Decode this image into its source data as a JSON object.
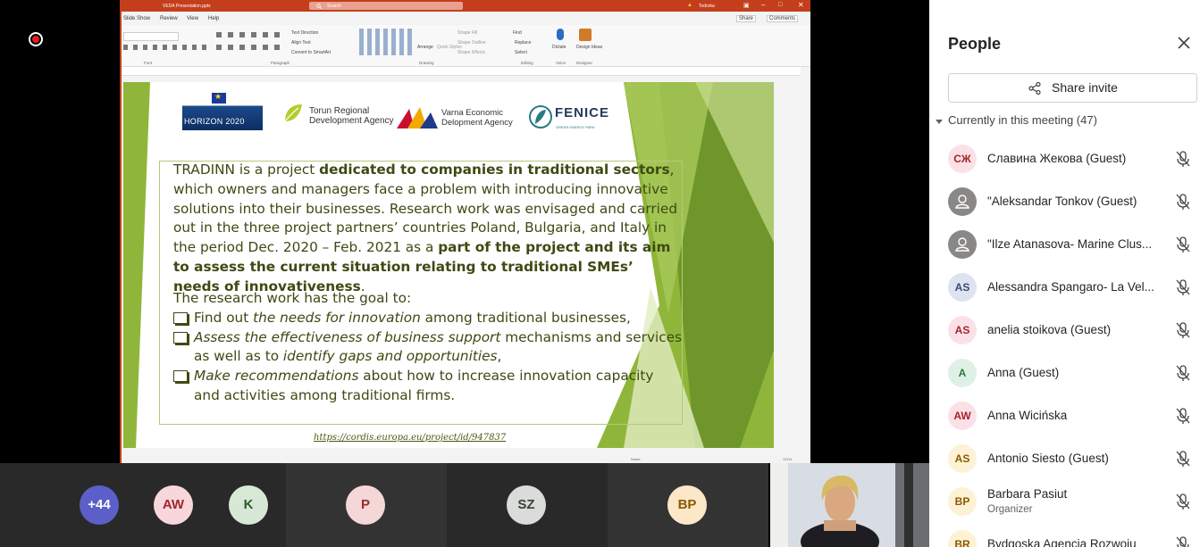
{
  "recording_indicator": "recording",
  "ppt": {
    "file_title": "VEDA Presentation.pptx",
    "search_placeholder": "Search",
    "user_name": "Todorka",
    "share_label": "Share",
    "comments_label": "Comments",
    "menus": [
      "Slide Show",
      "Review",
      "View",
      "Help"
    ],
    "ribbon_groups": [
      "Font",
      "Paragraph",
      "Drawing",
      "Editing",
      "Voice",
      "Designer"
    ],
    "ribbon_buttons": {
      "text_direction": "Text Direction",
      "align_text": "Align Text",
      "convert_smartart": "Convert to SmartArt",
      "arrange": "Arrange",
      "quick_styles": "Quick Styles",
      "shape_fill": "Shape Fill",
      "shape_outline": "Shape Outline",
      "shape_effects": "Shape Effects",
      "find": "Find",
      "replace": "Replace",
      "select": "Select",
      "dictate": "Dictate",
      "design_ideas": "Design Ideas"
    },
    "status": {
      "notes": "Notes",
      "zoom": "121%"
    }
  },
  "slide": {
    "logos": {
      "horizon": "HORIZON 2020",
      "torun": "Torun Regional Development Agency",
      "varna": "Varna Economic Delopment Agency",
      "fenice": "FENICE",
      "fenice_sub": "GREEN ENERGY PARK"
    },
    "para": {
      "p1": "TRADINN is a project ",
      "p1b": "dedicated to companies in traditional sectors",
      "p2": ", which owners and managers face a problem with introducing innovative solutions into their businesses.  Research work was envisaged and carried out in the three project partners’ countries Poland, Bulgaria, and Italy in the period Dec. 2020 – Feb. 2021 as a ",
      "p2b": "part of the project  and its aim to assess the current situation relating to traditional SMEs’ needs of innovativeness",
      "p3": "."
    },
    "goals_intro": "The research work has the goal to:",
    "goals": [
      {
        "pre": "Find out ",
        "em": "the needs for innovation",
        "post": " among traditional businesses,"
      },
      {
        "pre": "",
        "em": "Assess the effectiveness of business support",
        "post": " mechanisms and services as well as to  ",
        "em2": "identify gaps and opportunities",
        "post2": ","
      },
      {
        "pre": "",
        "em": "Make recommendations",
        "post": " about how to increase innovation capacity and activities among traditional firms."
      }
    ],
    "url": "https://cordis.europa.eu/project/id/947837"
  },
  "people": {
    "title": "People",
    "share_invite": "Share invite",
    "section": "Currently in this meeting (47)",
    "participants": [
      {
        "initials": "СЖ",
        "name": "Славина Жекова (Guest)",
        "role": "",
        "bg": "#fbe1e7",
        "fg": "#a4262c"
      },
      {
        "initials": "",
        "name": "\"Aleksandar Tonkov (Guest)",
        "role": "",
        "bg": "#8a8886",
        "fg": "#ffffff"
      },
      {
        "initials": "",
        "name": "\"Ilze Atanasova- Marine Clus...",
        "role": "",
        "bg": "#8a8886",
        "fg": "#ffffff"
      },
      {
        "initials": "AS",
        "name": "Alessandra Spangaro- La Vel...",
        "role": "",
        "bg": "#dee3f0",
        "fg": "#3b4a7c"
      },
      {
        "initials": "AS",
        "name": "anelia stoikova (Guest)",
        "role": "",
        "bg": "#fbe1e7",
        "fg": "#a4262c"
      },
      {
        "initials": "A",
        "name": "Anna (Guest)",
        "role": "",
        "bg": "#dff1e6",
        "fg": "#2b7a3e"
      },
      {
        "initials": "AW",
        "name": "Anna Wicińska",
        "role": "",
        "bg": "#fbe1e7",
        "fg": "#a4262c"
      },
      {
        "initials": "AS",
        "name": "Antonio Siesto (Guest)",
        "role": "",
        "bg": "#fdf2d6",
        "fg": "#8a5a00"
      },
      {
        "initials": "BP",
        "name": "Barbara Pasiut",
        "role": "Organizer",
        "bg": "#fdf2d6",
        "fg": "#8a5a00"
      },
      {
        "initials": "BR",
        "name": "Bydgoska Agencja Rozwoju",
        "role": "",
        "bg": "#fdf2d6",
        "fg": "#8a5a00"
      }
    ]
  },
  "gallery": [
    {
      "label": "+44",
      "bg": "#5b5fc7",
      "fg": "#ffffff"
    },
    {
      "label": "AW",
      "bg": "#f8d7dc",
      "fg": "#a4262c"
    },
    {
      "label": "K",
      "bg": "#d7e8d7",
      "fg": "#2b5b2b"
    },
    {
      "label": "P",
      "bg": "#f5d7d7",
      "fg": "#9b2c2c"
    },
    {
      "label": "SZ",
      "bg": "#d9dcd9",
      "fg": "#3d3d3d"
    },
    {
      "label": "BP",
      "bg": "#fde7c9",
      "fg": "#8a5a00"
    }
  ]
}
